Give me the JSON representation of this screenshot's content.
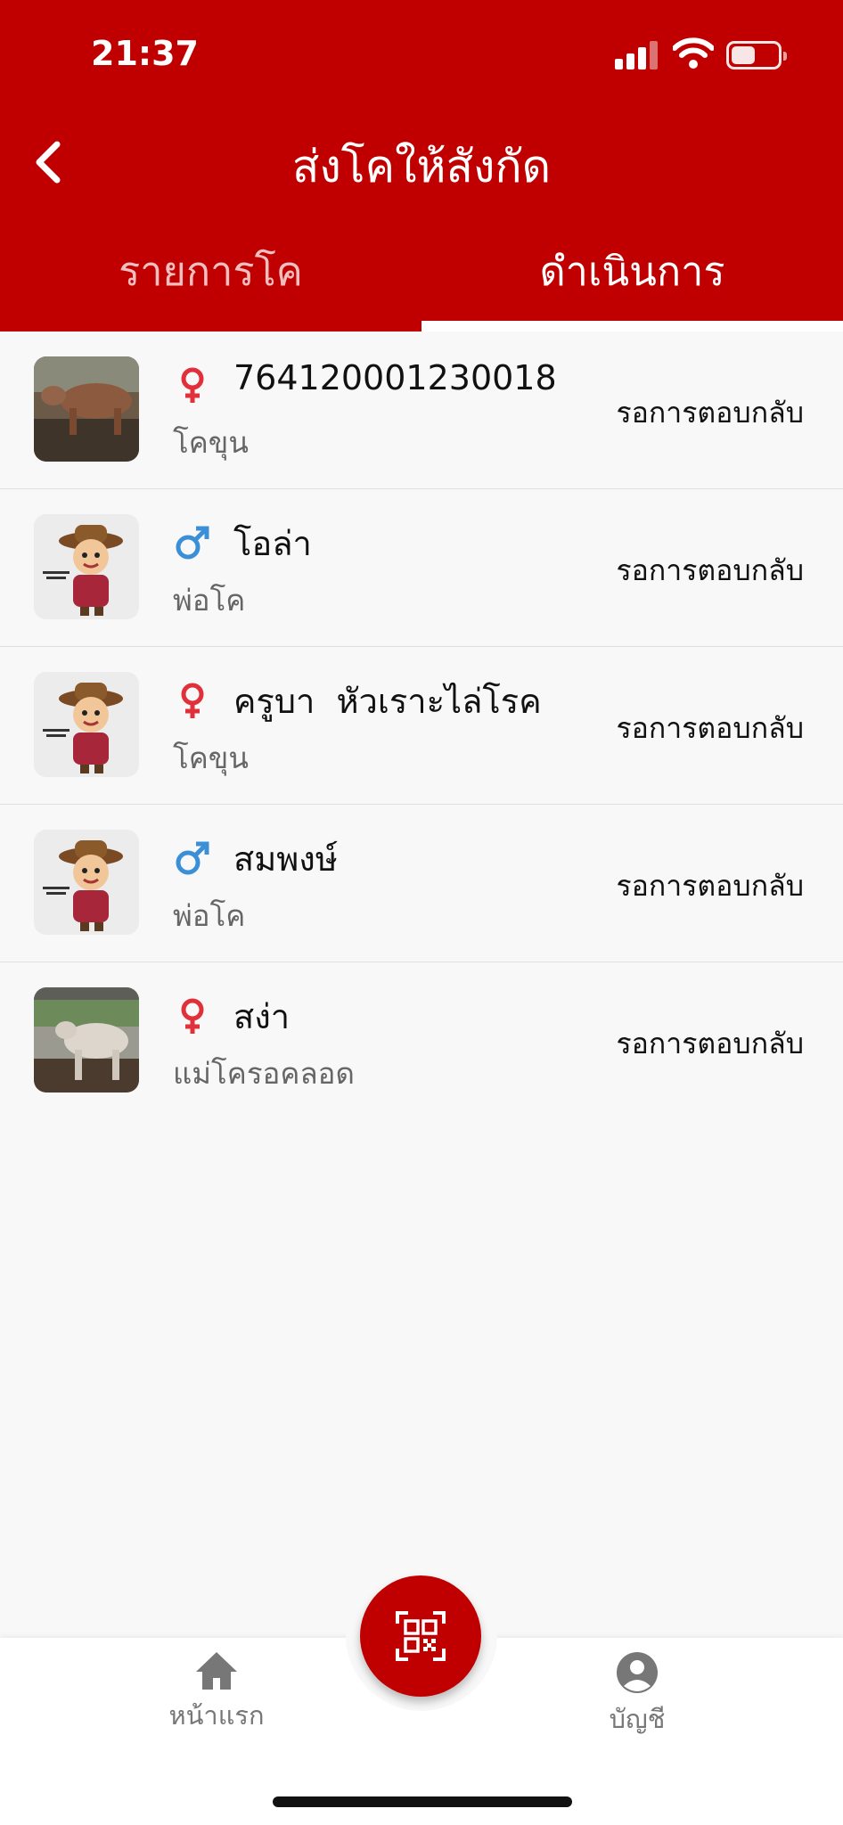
{
  "status_bar": {
    "time": "21:37"
  },
  "header": {
    "title": "ส่งโคให้สังกัด",
    "tabs": [
      {
        "label": "รายการโค",
        "active": false
      },
      {
        "label": "ดำเนินการ",
        "active": true
      }
    ]
  },
  "colors": {
    "brand": "#c00000",
    "female": "#e0303a",
    "male": "#3a8fd6"
  },
  "list": [
    {
      "name": "764120001230018",
      "type": "โคขุน",
      "gender": "female",
      "status": "รอการตอบกลับ",
      "image": "cow-photo"
    },
    {
      "name": "โอล่า",
      "type": "พ่อโค",
      "gender": "male",
      "status": "รอการตอบกลับ",
      "image": "farmer-cartoon"
    },
    {
      "name": "ครูบา  หัวเราะไล่โรค",
      "type": "โคขุน",
      "gender": "female",
      "status": "รอการตอบกลับ",
      "image": "farmer-cartoon"
    },
    {
      "name": "สมพงษ์",
      "type": "พ่อโค",
      "gender": "male",
      "status": "รอการตอบกลับ",
      "image": "farmer-cartoon"
    },
    {
      "name": "สง่า",
      "type": "แม่โครอคลอด",
      "gender": "female",
      "status": "รอการตอบกลับ",
      "image": "cow-photo"
    }
  ],
  "bottom_nav": {
    "home_label": "หน้าแรก",
    "account_label": "บัญชี",
    "scan_icon": "qr-scan-icon"
  }
}
